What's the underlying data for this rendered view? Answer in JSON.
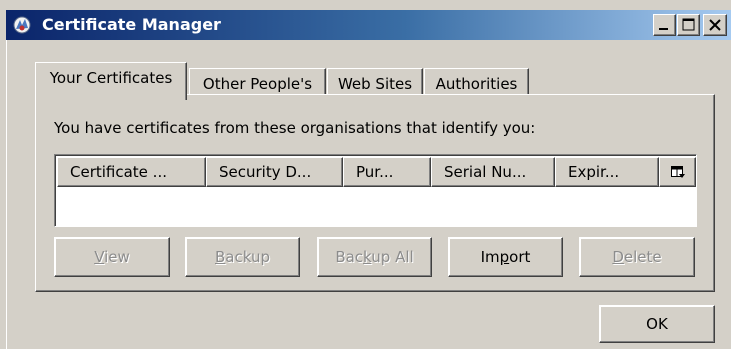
{
  "window": {
    "title": "Certificate Manager",
    "controls": [
      "minimize",
      "maximize",
      "close"
    ]
  },
  "tabs": [
    {
      "label": "Your Certificates",
      "active": true
    },
    {
      "label": "Other People's",
      "active": false
    },
    {
      "label": "Web Sites",
      "active": false
    },
    {
      "label": "Authorities",
      "active": false
    }
  ],
  "panel": {
    "description": "You have certificates from these organisations that identify you:",
    "columns": [
      "Certificate ...",
      "Security D...",
      "Pur...",
      "Serial Nu...",
      "Expir..."
    ],
    "column_picker_icon": "column-picker-icon",
    "rows": []
  },
  "buttons": {
    "view": {
      "pre": "",
      "key": "V",
      "post": "iew",
      "enabled": false
    },
    "backup": {
      "pre": "",
      "key": "B",
      "post": "ackup",
      "enabled": false
    },
    "backup_all": {
      "pre": "Bac",
      "key": "k",
      "post": "up All",
      "enabled": false
    },
    "import": {
      "pre": "Im",
      "key": "p",
      "post": "ort",
      "enabled": true
    },
    "delete": {
      "pre": "",
      "key": "D",
      "post": "elete",
      "enabled": false
    },
    "ok": {
      "label": "OK",
      "enabled": true
    }
  },
  "colors": {
    "titlebar_start": "#0a246a",
    "titlebar_end": "#a6caf0",
    "face": "#d4d0c8",
    "disabled_text": "#8c8c8c"
  }
}
